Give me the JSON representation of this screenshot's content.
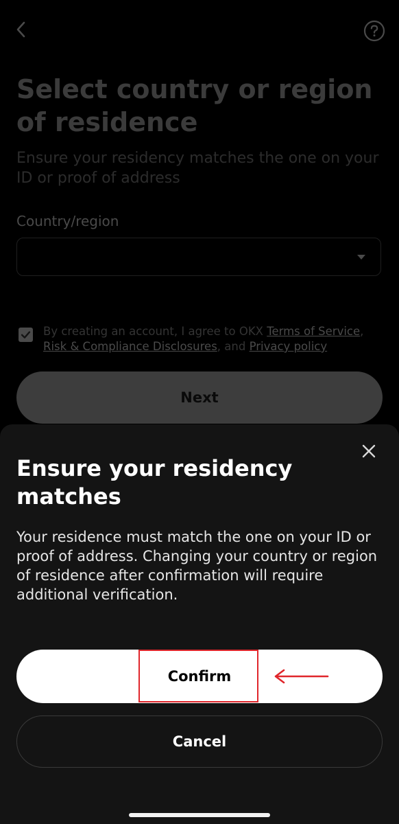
{
  "page": {
    "title": "Select country or region of residence",
    "subtitle": "Ensure your residency matches the one on your ID or proof of address",
    "country_label": "Country/region",
    "country_value": "",
    "agreement": {
      "prefix": "By creating an account, I agree to OKX ",
      "terms_link": "Terms of Service",
      "sep1": ", ",
      "risk_link": "Risk & Compliance Disclosures",
      "sep2": ", and ",
      "privacy_link": "Privacy policy",
      "checked": true
    },
    "next_label": "Next"
  },
  "sheet": {
    "title": "Ensure your residency matches",
    "body": "Your residence must match the one on your ID or proof of address. Changing your country or region of residence after confirmation will require additional verification.",
    "confirm_label": "Confirm",
    "cancel_label": "Cancel"
  },
  "icons": {
    "back": "chevron-left-icon",
    "help": "question-circle-icon",
    "dropdown": "caret-down-icon",
    "checkbox": "checkmark-icon",
    "close": "close-icon",
    "annotation": "arrow-left-icon"
  },
  "colors": {
    "background": "#000000",
    "sheet": "#141414",
    "primary_button": "#ffffff",
    "annotation": "#e0262b"
  }
}
